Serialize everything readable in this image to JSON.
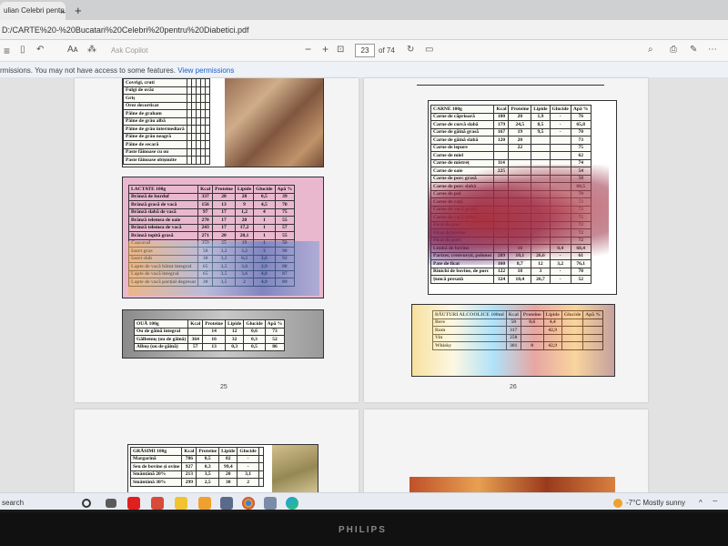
{
  "browser": {
    "tab_title": "ulian Celebri pentru...",
    "tab_close": "×",
    "new_tab": "+",
    "url": "D:/CARTE%20-%20Bucatari%20Celebri%20pentru%20Diabetici.pdf"
  },
  "pdf_toolbar": {
    "read_aloud": "Aᴀ",
    "ask_copilot": "Ask Copilot",
    "zoom_out": "−",
    "zoom_in": "+",
    "current_page": "23",
    "page_of": "of 74"
  },
  "notice": {
    "text": "rmissions. You may not have access to some features.",
    "link": "View permissions"
  },
  "pages": {
    "p25": {
      "number": "25",
      "cereale_rows": [
        [
          "Covrigi, cruti",
          "",
          "",
          "",
          "",
          ""
        ],
        [
          "Fulgi de ovăz",
          "",
          "",
          "",
          "",
          ""
        ],
        [
          "Griș",
          "",
          "",
          "",
          "",
          ""
        ],
        [
          "Orez decorticat",
          "",
          "",
          "",
          "",
          ""
        ],
        [
          "Pâine de graham",
          "",
          "",
          "",
          "",
          ""
        ],
        [
          "Pâine de grâu albă",
          "",
          "",
          "",
          "",
          ""
        ],
        [
          "Pâine de grâu intermediară",
          "",
          "",
          "",
          "",
          ""
        ],
        [
          "Pâine de grâu neagră",
          "",
          "",
          "",
          "",
          ""
        ],
        [
          "Pâine de secară",
          "",
          "",
          "",
          "",
          ""
        ],
        [
          "Paste făinoase cu ou",
          "",
          "",
          "",
          "",
          ""
        ],
        [
          "Paste făinoase obișnuite",
          "",
          "",
          "",
          "",
          ""
        ]
      ],
      "lactate_header": [
        "LACTATE\n100g",
        "Kcal",
        "Proteine",
        "Lipide",
        "Glucide",
        "Apă %"
      ],
      "lactate_rows": [
        [
          "Brânză de burduf",
          "337",
          "28",
          "28",
          "0,5",
          "39"
        ],
        [
          "Brânză grasă de vacă",
          "156",
          "13",
          "9",
          "4,5",
          "70"
        ],
        [
          "Brânză slabă de vacă",
          "97",
          "17",
          "1,2",
          "4",
          "75"
        ],
        [
          "Brânză telemea de oaie",
          "270",
          "17",
          "20",
          "1",
          "55"
        ],
        [
          "Brânză telemea de vacă",
          "243",
          "17",
          "17,2",
          "1",
          "57"
        ],
        [
          "Brânză topită grasă",
          "271",
          "20",
          "20,1",
          "1",
          "55"
        ],
        [
          "Cașcaval",
          "359",
          "25",
          "19",
          "1",
          "50"
        ],
        [
          "Iaurt gras",
          "58",
          "3,2",
          "3,2",
          "3",
          "90"
        ],
        [
          "Iaurt slab",
          "30",
          "3,2",
          "0,2",
          "3,6",
          "92"
        ],
        [
          "Lapte de vacă bătut integral",
          "65",
          "3,5",
          "3,6",
          "3,9",
          "88"
        ],
        [
          "Lapte de vacă integral",
          "65",
          "3,5",
          "3,6",
          "4,8",
          "87"
        ],
        [
          "Lapte de vacă parțial degresat",
          "30",
          "3,5",
          "2",
          "4,9",
          "89"
        ]
      ],
      "oua_header": [
        "OUĂ 100g",
        "Kcal",
        "Proteine",
        "Lipide",
        "Glucide",
        "Apă %"
      ],
      "oua_rows": [
        [
          "Ou de găină integral",
          "",
          "14",
          "12",
          "0,6",
          "73"
        ],
        [
          "Gălbenuș (ou de găină)",
          "364",
          "16",
          "32",
          "0,3",
          "52"
        ],
        [
          "Albuș (ou de găină)",
          "57",
          "13",
          "0,3",
          "0,5",
          "86"
        ]
      ]
    },
    "p26": {
      "number": "26",
      "carne_header": [
        "CARNE\n100g",
        "Kcal",
        "Proteine",
        "Lipide",
        "Glucide",
        "Apă %"
      ],
      "carne_rows": [
        [
          "Carne de căprioară",
          "100",
          "20",
          "1,9",
          "-",
          "76"
        ],
        [
          "Carne de curcă slabă",
          "179",
          "24,5",
          "8,5",
          "-",
          "65,8"
        ],
        [
          "Carne de găină grasă",
          "167",
          "19",
          "9,5",
          "-",
          "70"
        ],
        [
          "Carne de găină slabă",
          "120",
          "20",
          "",
          "",
          "73"
        ],
        [
          "Carne de iepure",
          "",
          "22",
          "",
          "",
          "75"
        ],
        [
          "Carne de miel",
          "",
          "",
          "",
          "",
          "62"
        ],
        [
          "Carne de mistreț",
          "114",
          "",
          "",
          "",
          "74"
        ],
        [
          "Carne de oaie",
          "225",
          "",
          "",
          "",
          "54"
        ],
        [
          "Carne de porc grasă",
          "",
          "",
          "",
          "",
          "58"
        ],
        [
          "Carne de porc slabă",
          "",
          "",
          "",
          "",
          "60,5"
        ],
        [
          "Carne de pui",
          "",
          "",
          "",
          "",
          "70"
        ],
        [
          "Carne de rață",
          "",
          "",
          "",
          "",
          "72"
        ],
        [
          "Carne de vacă grasă",
          "",
          "",
          "",
          "",
          "72"
        ],
        [
          "Carne de vacă slabă",
          "",
          "",
          "",
          "",
          "75"
        ],
        [
          "Ficat de porc",
          "",
          "",
          "",
          "",
          "72"
        ],
        [
          "Ficat de bovine",
          "",
          "",
          "",
          "",
          "72"
        ],
        [
          "Ficat de porc",
          "",
          "",
          "",
          "",
          "72"
        ],
        [
          "Limbă de bovine",
          "",
          "16",
          "",
          "0,4",
          "68,4"
        ],
        [
          "Parizer, crenvurști, polonez",
          "289",
          "10,1",
          "26,6",
          "-",
          "61"
        ],
        [
          "Pate de ficat",
          "160",
          "8,7",
          "12",
          "3,2",
          "76,1"
        ],
        [
          "Rinichi de bovine, de porc",
          "122",
          "18",
          "3",
          "-",
          "78"
        ],
        [
          "Șuncă presată",
          "324",
          "18,4",
          "26,7",
          "-",
          "52"
        ]
      ],
      "bauturi_header": [
        "BĂUTURI ALCOOLICE\n100ml",
        "Kcal",
        "Proteine",
        "Lipide",
        "Glucide",
        "Apă %"
      ],
      "bauturi_rows": [
        [
          "Bere",
          "50",
          "0,6",
          "4,4",
          "",
          ""
        ],
        [
          "Rom",
          "317",
          "",
          "42,9",
          "",
          ""
        ],
        [
          "Vin",
          "250",
          "",
          "",
          "",
          ""
        ],
        [
          "Whisky",
          "301",
          "0",
          "42,9",
          "",
          ""
        ]
      ]
    },
    "p27": {
      "grasimi_header": [
        "GRĂSIMI\n100g",
        "Kcal",
        "Proteine",
        "Lipide",
        "Glucide",
        ""
      ],
      "grasimi_rows": [
        [
          "Margarină",
          "786",
          "0,5",
          "82",
          "-",
          ""
        ],
        [
          "Seu de bovine și ovine",
          "927",
          "0,3",
          "99,4",
          "-",
          ""
        ],
        [
          "Smântână 20%",
          "213",
          "3,5",
          "20",
          "3,1",
          ""
        ],
        [
          "Smântână 30%",
          "299",
          "2,5",
          "30",
          "2",
          ""
        ]
      ]
    }
  },
  "taskbar": {
    "search": "search",
    "weather": "-7°C  Mostly sunny"
  },
  "monitor": {
    "brand": "PHILIPS"
  }
}
